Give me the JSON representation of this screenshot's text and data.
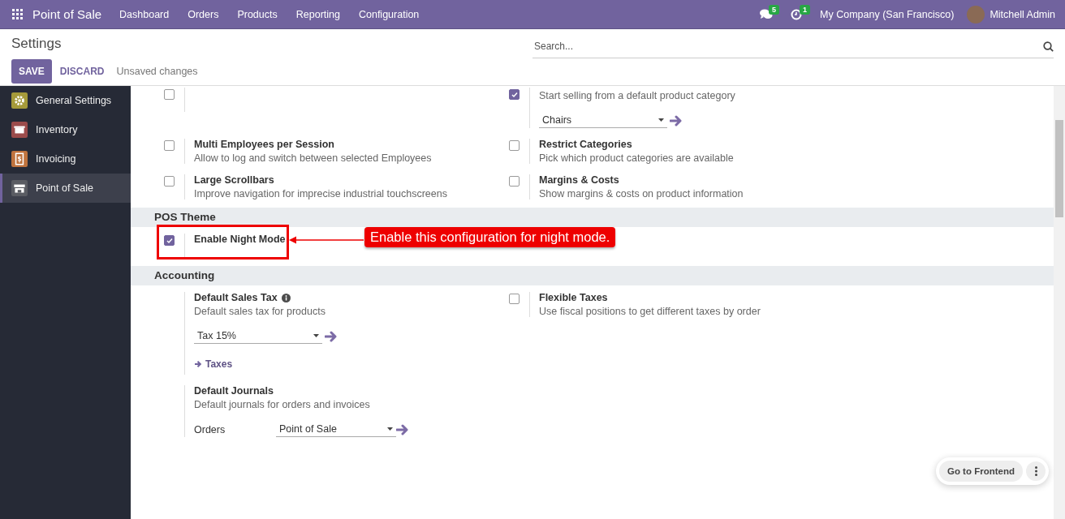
{
  "navbar": {
    "app_name": "Point of Sale",
    "menus": [
      "Dashboard",
      "Orders",
      "Products",
      "Reporting",
      "Configuration"
    ],
    "messages_count": "5",
    "activities_count": "1",
    "company": "My Company (San Francisco)",
    "user": "Mitchell Admin"
  },
  "control_panel": {
    "title": "Settings",
    "search": {
      "placeholder": "Search..."
    },
    "buttons": [
      {
        "label": "SAVE",
        "kind": "primary"
      },
      {
        "label": "DISCARD",
        "kind": "secondary"
      }
    ],
    "status": "Unsaved changes"
  },
  "sidebar": {
    "items": [
      {
        "label": "General Settings",
        "selected": false
      },
      {
        "label": "Inventory",
        "selected": false
      },
      {
        "label": "Invoicing",
        "selected": false
      },
      {
        "label": "Point of Sale",
        "selected": true
      }
    ]
  },
  "sections": [
    {
      "settings": [
        {
          "kind": "checkbox",
          "checked": false
        },
        {
          "kind": "checkbox",
          "checked": true,
          "description": "Start selling from a default product category",
          "select": {
            "value": "Chairs"
          }
        },
        {
          "kind": "checkbox",
          "checked": false,
          "title": "Multi Employees per Session",
          "description": "Allow to log and switch between selected Employees"
        },
        {
          "kind": "checkbox",
          "checked": false,
          "title": "Restrict Categories",
          "description": "Pick which product categories are available"
        },
        {
          "kind": "checkbox",
          "checked": false,
          "title": "Large Scrollbars",
          "description": "Improve navigation for imprecise industrial touchscreens"
        },
        {
          "kind": "checkbox",
          "checked": false,
          "title": "Margins & Costs",
          "description": "Show margins & costs on product information"
        }
      ]
    },
    {
      "title": "POS Theme",
      "settings": [
        {
          "kind": "checkbox",
          "checked": true,
          "title": "Enable Night Mode",
          "annotation": "Enable this configuration for night mode."
        }
      ]
    },
    {
      "title": "Accounting",
      "settings": [
        {
          "kind": "field",
          "title": "Default Sales Tax",
          "info": true,
          "description": "Default sales tax for products",
          "select": {
            "value": "Tax 15%"
          },
          "link": "Taxes"
        },
        {
          "kind": "checkbox",
          "checked": false,
          "title": "Flexible Taxes",
          "description": "Use fiscal positions to get different taxes by order"
        },
        {
          "kind": "field",
          "title": "Default Journals",
          "description": "Default journals for orders and invoices",
          "journals": [
            {
              "label": "Orders",
              "value": "Point of Sale"
            }
          ]
        }
      ]
    }
  ],
  "floating": {
    "button": "Go to Frontend"
  }
}
